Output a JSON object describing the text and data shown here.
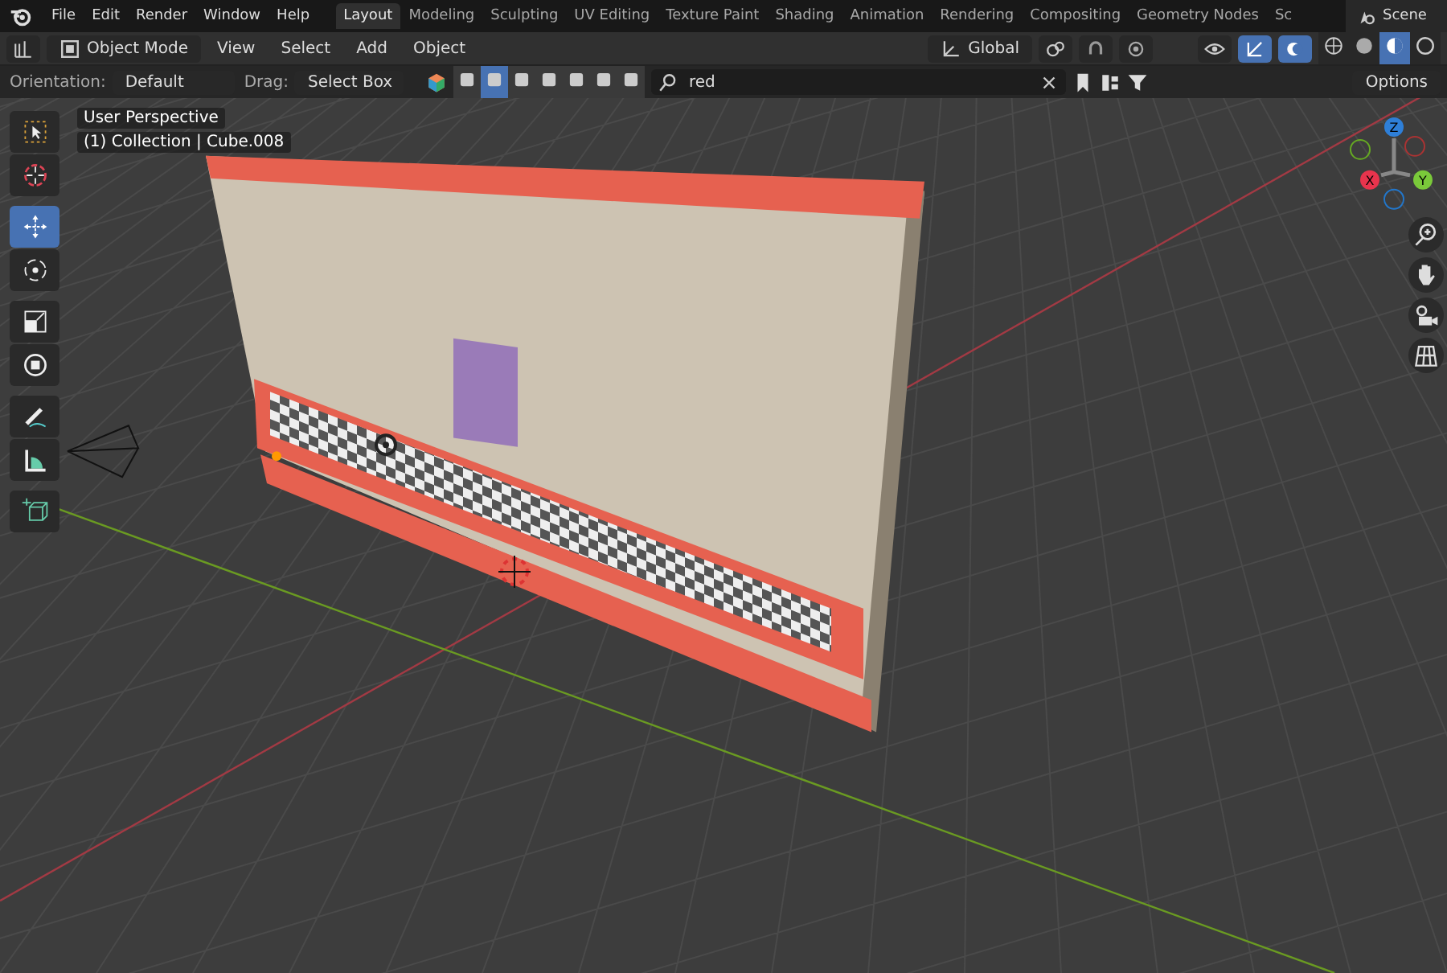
{
  "menus": [
    "File",
    "Edit",
    "Render",
    "Window",
    "Help"
  ],
  "workspaces": [
    {
      "label": "Layout",
      "selected": true
    },
    {
      "label": "Modeling",
      "selected": false
    },
    {
      "label": "Sculpting",
      "selected": false
    },
    {
      "label": "UV Editing",
      "selected": false
    },
    {
      "label": "Texture Paint",
      "selected": false
    },
    {
      "label": "Shading",
      "selected": false
    },
    {
      "label": "Animation",
      "selected": false
    },
    {
      "label": "Rendering",
      "selected": false
    },
    {
      "label": "Compositing",
      "selected": false
    },
    {
      "label": "Geometry Nodes",
      "selected": false
    },
    {
      "label": "Sc",
      "selected": false
    }
  ],
  "scene": "Scene",
  "header": {
    "mode": "Object Mode",
    "menus": [
      "View",
      "Select",
      "Add",
      "Object"
    ],
    "orientation": "Global",
    "shading": [
      {
        "kind": "wire",
        "selected": false
      },
      {
        "kind": "solid",
        "selected": false
      },
      {
        "kind": "material",
        "selected": true
      },
      {
        "kind": "rendered",
        "selected": false
      }
    ]
  },
  "tool_settings": {
    "orientation_label": "Orientation:",
    "orientation": "Default",
    "drag_label": "Drag:",
    "drag": "Select Box",
    "filters": [
      {
        "selected": false
      },
      {
        "selected": true
      },
      {
        "selected": false
      },
      {
        "selected": false
      },
      {
        "selected": false
      },
      {
        "selected": false
      },
      {
        "selected": false
      }
    ],
    "search": "red",
    "options": "Options"
  },
  "viewport": {
    "perspective": "User Perspective",
    "collection": "(1) Collection | Cube.008",
    "tools": [
      {
        "kind": "select",
        "selected": false
      },
      {
        "kind": "cursor",
        "selected": false
      },
      {
        "kind": "move",
        "selected": true
      },
      {
        "kind": "rotate",
        "selected": false
      },
      {
        "kind": "scale",
        "selected": false
      },
      {
        "kind": "transform",
        "selected": false
      },
      {
        "kind": "annotate",
        "selected": false
      },
      {
        "kind": "measure",
        "selected": false
      },
      {
        "kind": "add-cube",
        "selected": false
      }
    ],
    "axes": [
      "Z",
      "X",
      "Y"
    ]
  }
}
